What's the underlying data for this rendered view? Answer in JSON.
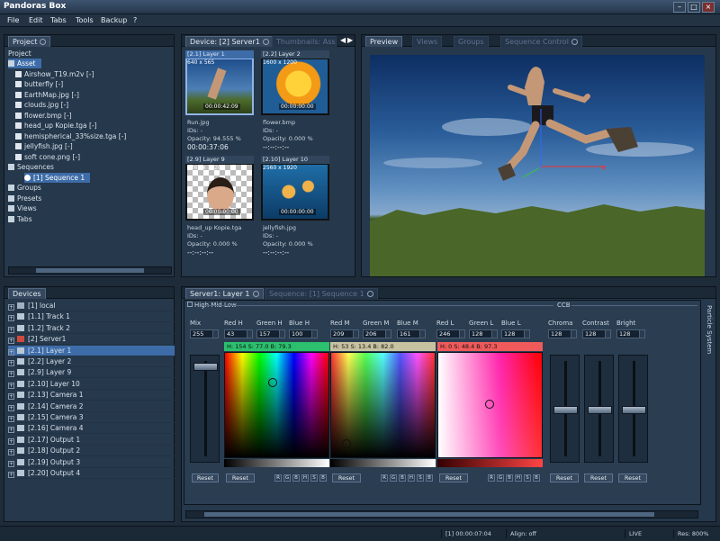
{
  "window": {
    "title": "Pandoras Box"
  },
  "menu": [
    "File",
    "Edit",
    "Tabs",
    "Tools",
    "Backup",
    "?"
  ],
  "project_panel": {
    "tab": "Project",
    "root": "Project",
    "items": [
      {
        "label": "Asset",
        "selected": true,
        "type": "folder"
      },
      {
        "label": "Airshow_T19.m2v [-]",
        "type": "file"
      },
      {
        "label": "butterfly [-]",
        "type": "file"
      },
      {
        "label": "EarthMap.jpg [-]",
        "type": "file"
      },
      {
        "label": "clouds.jpg [-]",
        "type": "file"
      },
      {
        "label": "flower.bmp [-]",
        "type": "file"
      },
      {
        "label": "head_up Kopie.tga [-]",
        "type": "file"
      },
      {
        "label": "hemispherical_33%size.tga [-]",
        "type": "file"
      },
      {
        "label": "jellyfish.jpg [-]",
        "type": "file"
      },
      {
        "label": "soft cone.png [-]",
        "type": "file"
      },
      {
        "label": "Sequences",
        "type": "folder"
      },
      {
        "label": "[1] Sequence 1",
        "type": "seq",
        "selected": true
      },
      {
        "label": "Groups",
        "type": "folder"
      },
      {
        "label": "Presets",
        "type": "folder"
      },
      {
        "label": "Views",
        "type": "folder"
      },
      {
        "label": "Tabs",
        "type": "folder"
      }
    ]
  },
  "device_panel": {
    "tabs": [
      "Device: [2] Server1",
      "Thumbnails: Asset"
    ],
    "thumbs": [
      {
        "header": "[2.1] Layer 1",
        "size": "640 x 565",
        "timecode": "00:00:42:09",
        "name": "Run.jpg",
        "ids": "IDs: -",
        "opacity": "Opacity: 94.555 %",
        "time": "00:00:37:06",
        "active": true
      },
      {
        "header": "[2.2] Layer 2",
        "size": "1600 x 1200",
        "timecode": "00:00:00:00",
        "name": "flower.bmp",
        "ids": "IDs: -",
        "opacity": "Opacity: 0.000 %",
        "time": "--:--:--:--",
        "active": false
      },
      {
        "header": "[2.9] Layer 9",
        "size": "1263 x 1020",
        "timecode": "00:00:00:00",
        "name": "head_up Kopie.tga",
        "ids": "IDs: -",
        "opacity": "Opacity: 0.000 %",
        "time": "--:--:--:--",
        "active": false
      },
      {
        "header": "[2.10] Layer 10",
        "size": "2560 x 1920",
        "timecode": "00:00:00:00",
        "name": "jellyfish.jpg",
        "ids": "IDs: -",
        "opacity": "Opacity: 0.000 %",
        "time": "--:--:--:--",
        "active": false
      }
    ]
  },
  "preview_panel": {
    "tabs": [
      "Preview",
      "Views",
      "Groups",
      "Sequence Control"
    ]
  },
  "devices_panel": {
    "tab": "Devices",
    "rows": [
      {
        "label": "[1] local",
        "icon": "device-icon"
      },
      {
        "label": "[1.1] Track 1",
        "icon": "track-icon"
      },
      {
        "label": "[1.2] Track 2",
        "icon": "track-icon"
      },
      {
        "label": "[2] Server1",
        "icon": "server-icon"
      },
      {
        "label": "[2.1] Layer 1",
        "icon": "layer-icon",
        "selected": true
      },
      {
        "label": "[2.2] Layer 2",
        "icon": "layer-icon"
      },
      {
        "label": "[2.9] Layer 9",
        "icon": "layer-icon"
      },
      {
        "label": "[2.10] Layer 10",
        "icon": "layer-icon"
      },
      {
        "label": "[2.13] Camera 1",
        "icon": "camera-icon"
      },
      {
        "label": "[2.14] Camera 2",
        "icon": "camera-icon"
      },
      {
        "label": "[2.15] Camera 3",
        "icon": "camera-icon"
      },
      {
        "label": "[2.16] Camera 4",
        "icon": "camera-icon"
      },
      {
        "label": "[2.17] Output 1",
        "icon": "output-icon"
      },
      {
        "label": "[2.18] Output 2",
        "icon": "output-icon"
      },
      {
        "label": "[2.19] Output 3",
        "icon": "output-icon"
      },
      {
        "label": "[2.20] Output 4",
        "icon": "output-icon"
      }
    ]
  },
  "layer_panel": {
    "tabs": [
      "Server1: Layer 1",
      "Sequence: [1] Sequence 1"
    ],
    "group_label": "High Mid Low",
    "ccb_label": "CCB",
    "side_label": "Particle System",
    "mix": {
      "label": "Mix",
      "value": "255"
    },
    "fields": [
      {
        "label": "Red H",
        "value": "43"
      },
      {
        "label": "Green H",
        "value": "157"
      },
      {
        "label": "Blue H",
        "value": "100"
      },
      {
        "label": "Red M",
        "value": "209"
      },
      {
        "label": "Green M",
        "value": "206"
      },
      {
        "label": "Blue M",
        "value": "161"
      },
      {
        "label": "Red L",
        "value": "246"
      },
      {
        "label": "Green L",
        "value": "128"
      },
      {
        "label": "Blue L",
        "value": "128"
      }
    ],
    "ccb_fields": [
      {
        "label": "Chroma",
        "value": "128"
      },
      {
        "label": "Contrast",
        "value": "128"
      },
      {
        "label": "Bright",
        "value": "128"
      }
    ],
    "hsb": [
      "H: 154 S: 77.0 B: 79.3",
      "H: 53 S: 13.4 B: 82.0",
      "H: 0 S: 48.4 B: 97.3"
    ],
    "reset_label": "Reset",
    "mini_buttons": [
      "R",
      "G",
      "B",
      "H",
      "S",
      "B"
    ]
  },
  "statusbar": {
    "timecode": "[1] 00:00:07:04",
    "align": "Align: off",
    "mode": "LIVE",
    "res": "Res: 800%"
  },
  "colors": {
    "accent": "#3d6ca8",
    "panel": "#26384b",
    "bg": "#1e2b38"
  }
}
